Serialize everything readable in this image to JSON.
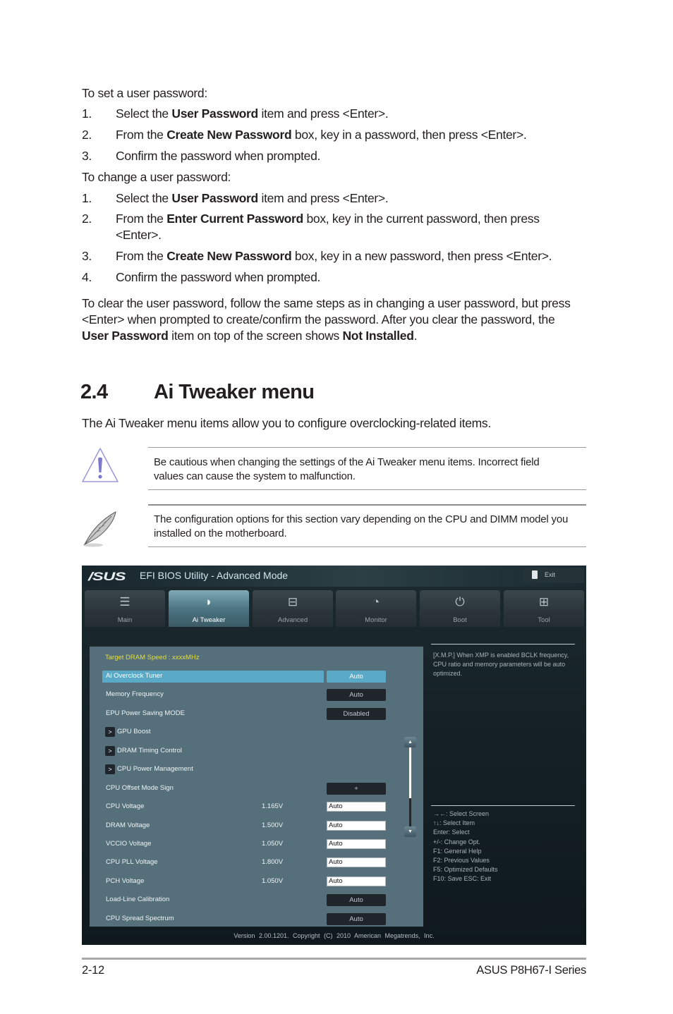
{
  "doc": {
    "set_heading": "To set a user password:",
    "set_steps": [
      {
        "num": "1.",
        "pre": "Select the ",
        "bold": "User Password",
        "post": " item and press <Enter>."
      },
      {
        "num": "2.",
        "pre": "From the ",
        "bold": "Create New Password",
        "post": " box, key in a password, then press <Enter>."
      },
      {
        "num": "3.",
        "pre": "Confirm the password when prompted.",
        "bold": "",
        "post": ""
      }
    ],
    "change_heading": "To change a user password:",
    "change_steps": [
      {
        "num": "1.",
        "pre": "Select the ",
        "bold": "User Password",
        "post": " item and press <Enter>."
      },
      {
        "num": "2.",
        "pre": "From the ",
        "bold": "Enter Current Password",
        "post": " box, key in the current password, then press",
        "cont": "<Enter>."
      },
      {
        "num": "3.",
        "pre": "From the ",
        "bold": "Create New Password",
        "post": " box, key in a new password, then press <Enter>."
      },
      {
        "num": "4.",
        "pre": "Confirm the password when prompted.",
        "bold": "",
        "post": ""
      }
    ],
    "clear_para": {
      "line1": "To clear the user password, follow the same steps as in changing a user password, but press",
      "line2": "<Enter> when prompted to create/confirm the password. After you clear the password, the",
      "line3_bold1": "User Password",
      "line3_mid": " item on top of the screen shows ",
      "line3_bold2": "Not Installed",
      "line3_end": "."
    },
    "section_number": "2.4",
    "section_title": "Ai Tweaker menu",
    "intro": "The Ai Tweaker menu items allow you to configure overclocking-related items.",
    "warning_note": {
      "icon": "warning-triangle-icon",
      "line1": "Be cautious when changing the settings of the Ai Tweaker menu items. Incorrect field",
      "line2": "values can cause the system to malfunction."
    },
    "info_note": {
      "icon": "feather-pen-icon",
      "line1": "The configuration options for this section vary depending on the CPU and DIMM model you",
      "line2": "installed on the motherboard."
    },
    "footer": {
      "page": "2-12",
      "product": "ASUS P8H67-I Series"
    }
  },
  "bios": {
    "logo": "/SUS",
    "title": "EFI BIOS Utility - Advanced Mode",
    "exit_label": "Exit",
    "tabs": [
      {
        "label": "Main",
        "icon": "list-icon",
        "glyph": "☰",
        "active": false
      },
      {
        "label": "Ai  Tweaker",
        "icon": "ai-tweaker-icon",
        "glyph": "◗",
        "active": true
      },
      {
        "label": "Advanced",
        "icon": "advanced-settings-icon",
        "glyph": "⊟",
        "active": false
      },
      {
        "label": "Monitor",
        "icon": "monitor-gauge-icon",
        "glyph": "◔",
        "active": false
      },
      {
        "label": "Boot",
        "icon": "power-icon",
        "glyph": "⏻",
        "active": false
      },
      {
        "label": "Tool",
        "icon": "toolbox-icon",
        "glyph": "⊞",
        "active": false
      }
    ],
    "target_dram": "Target DRAM Speed : xxxxMHz",
    "items": [
      {
        "label": "Ai Overclock Tuner",
        "type": "dropdown",
        "value": "Auto",
        "selected": true
      },
      {
        "label": "Memory Frequency",
        "type": "dropdown",
        "value": "Auto"
      },
      {
        "label": "EPU Power Saving MODE",
        "type": "dropdown",
        "value": "Disabled"
      },
      {
        "label": "GPU Boost",
        "type": "submenu",
        "arrow": ">"
      },
      {
        "label": "DRAM Timing Control",
        "type": "submenu",
        "arrow": ">"
      },
      {
        "label": "CPU Power Management",
        "type": "submenu",
        "arrow": ">"
      },
      {
        "label": "CPU Offset Mode Sign",
        "type": "dropdown",
        "value": "+"
      },
      {
        "label": "CPU Voltage",
        "type": "input",
        "reading": "1.165V",
        "value": "Auto"
      },
      {
        "label": "DRAM Voltage",
        "type": "input",
        "reading": "1.500V",
        "value": "Auto"
      },
      {
        "label": "VCCIO Voltage",
        "type": "input",
        "reading": "1.050V",
        "value": "Auto"
      },
      {
        "label": "CPU PLL Voltage",
        "type": "input",
        "reading": "1.800V",
        "value": "Auto"
      },
      {
        "label": "PCH Voltage",
        "type": "input",
        "reading": "1.050V",
        "value": "Auto"
      },
      {
        "label": "Load-Line Calibration",
        "type": "dropdown",
        "value": "Auto"
      },
      {
        "label": "CPU Spread Spectrum",
        "type": "dropdown",
        "value": "Auto"
      }
    ],
    "scroll": {
      "up": "▲",
      "down": "▼"
    },
    "help_text": "[X.M.P.] When XMP is enabled BCLK frequency, CPU ratio and memory parameters will be auto optimized.",
    "keys": [
      "→←:  Select Screen",
      "↑↓:  Select Item",
      "Enter:  Select",
      "+/-:  Change Opt.",
      "F1:  General Help",
      "F2:  Previous Values",
      "F5:  Optimized Defaults",
      "F10:  Save    ESC:  Exit"
    ],
    "footer": "Version 2.00.1201. Copyright (C) 2010 American Megatrends, Inc."
  }
}
